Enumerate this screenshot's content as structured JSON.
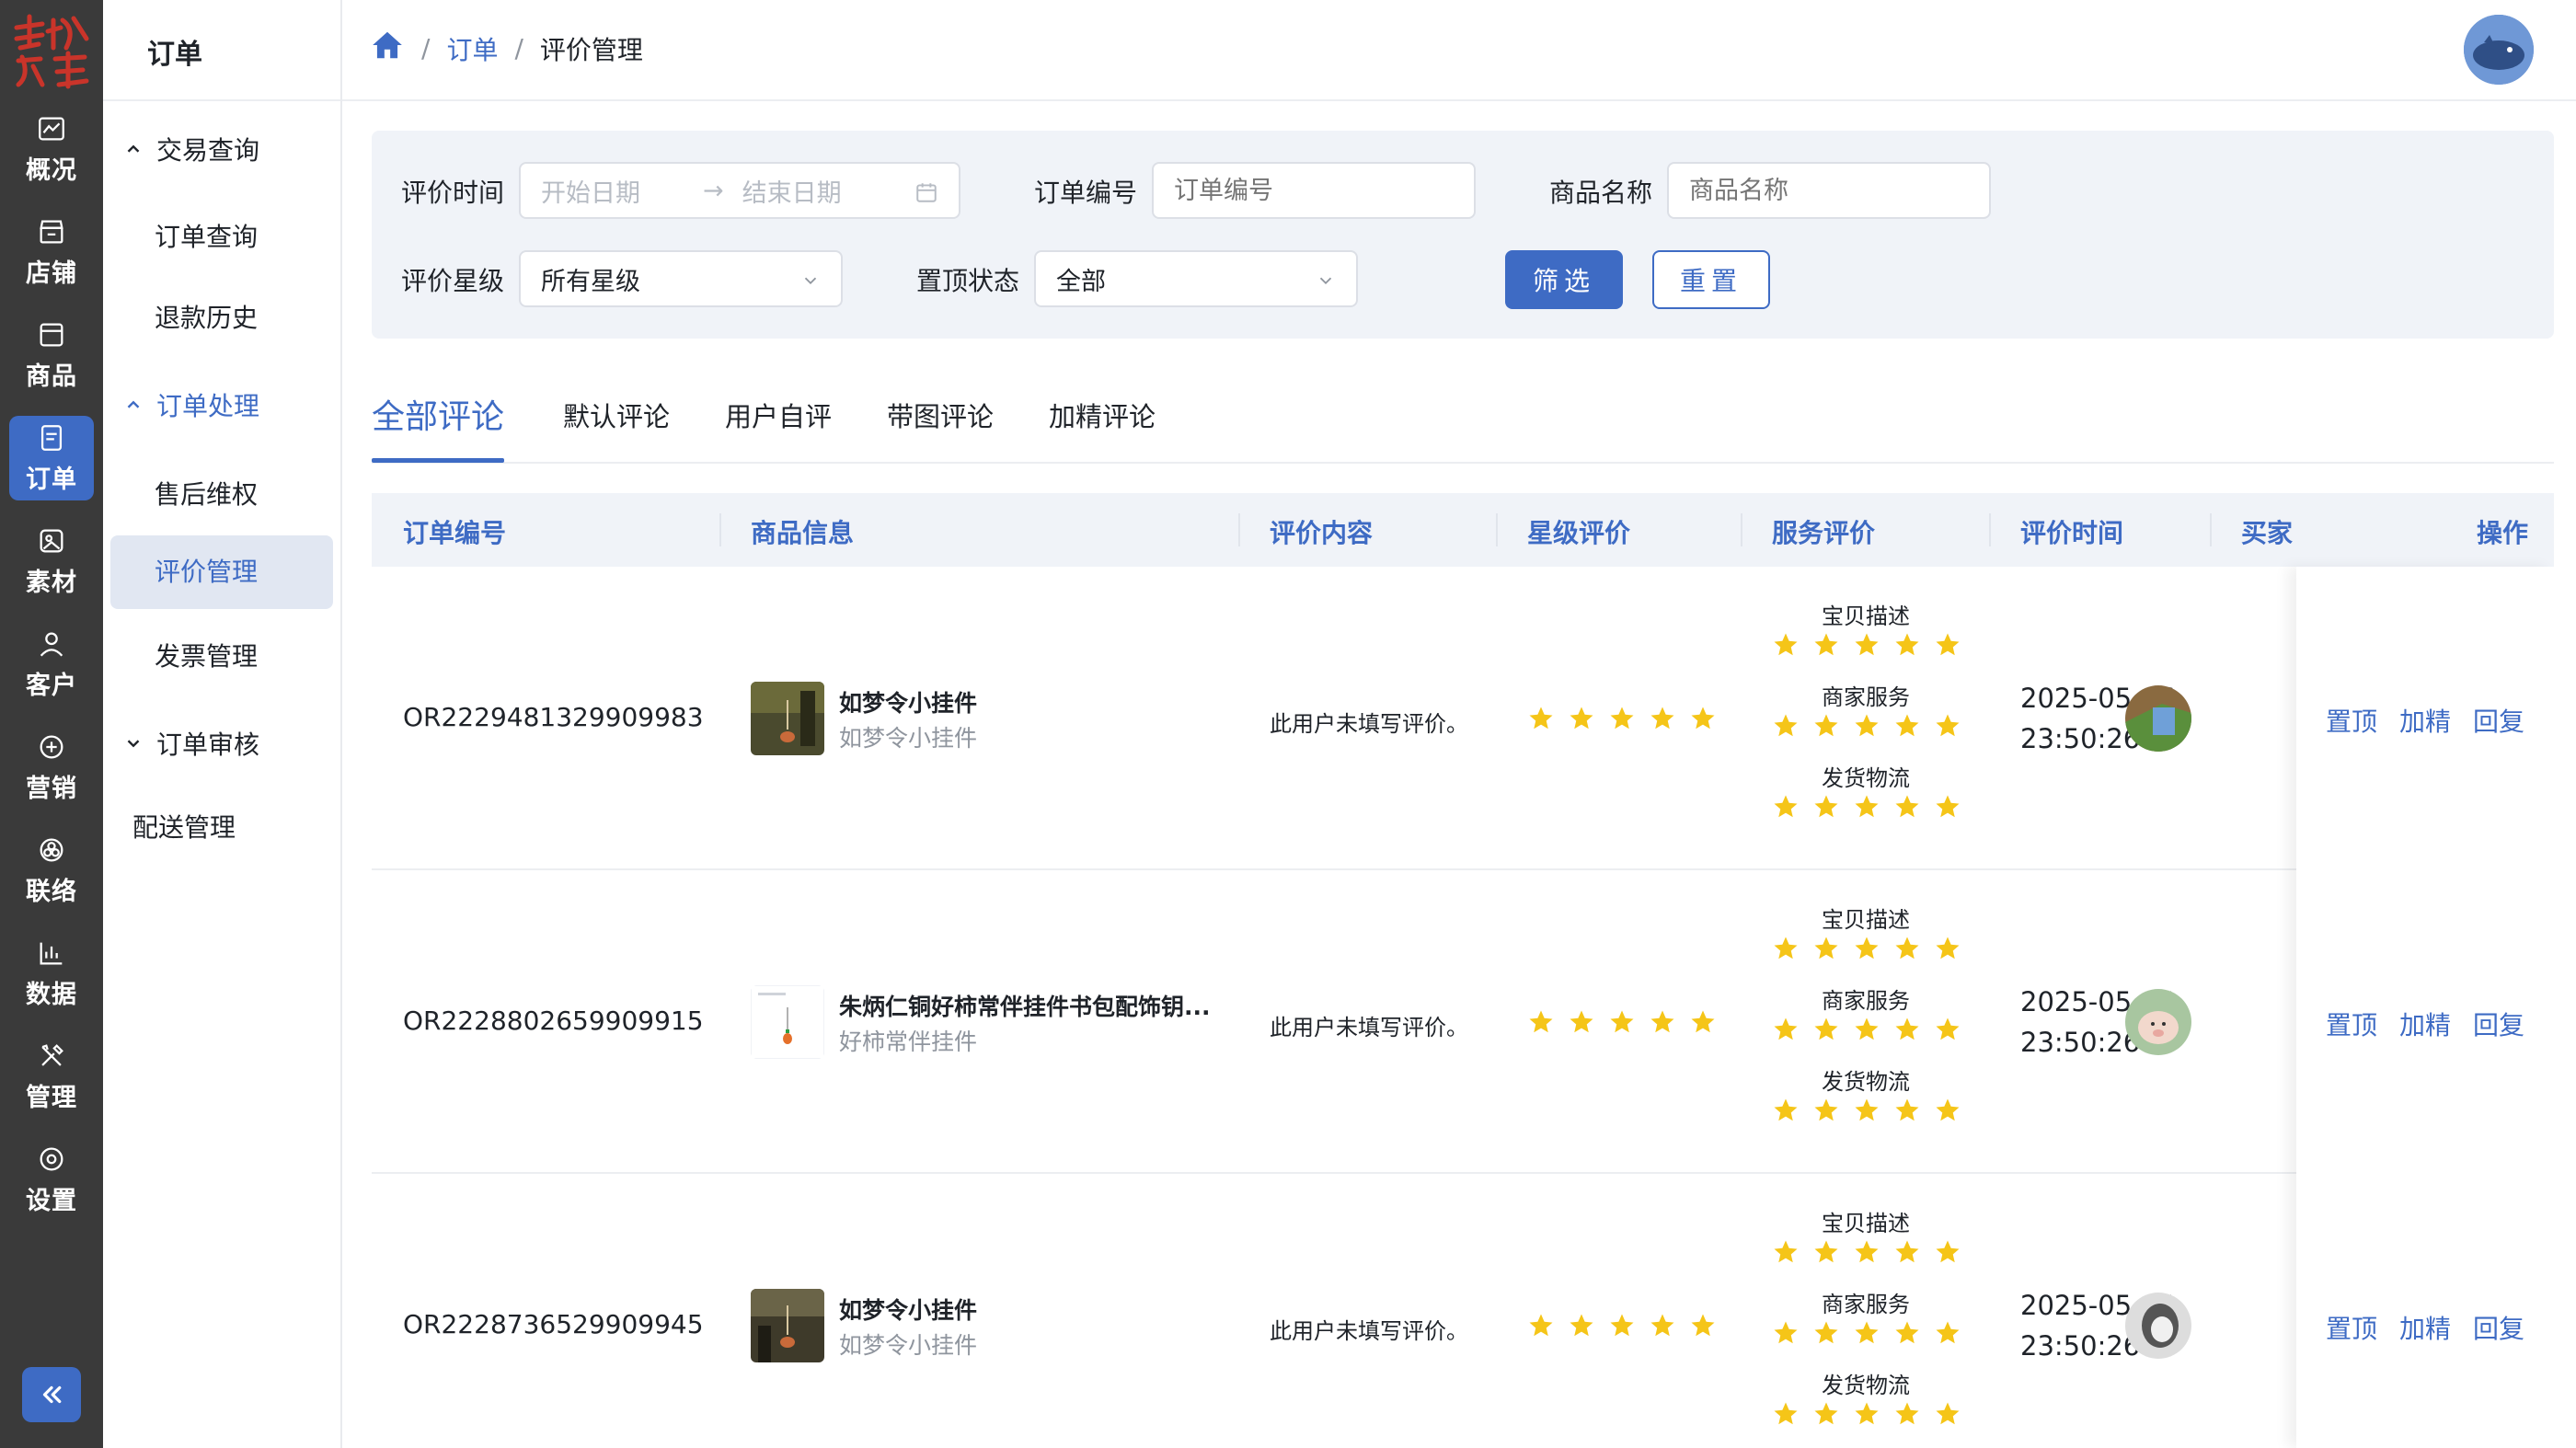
{
  "rail": {
    "items": [
      {
        "label": "概况",
        "icon": "chart-icon"
      },
      {
        "label": "店铺",
        "icon": "store-icon"
      },
      {
        "label": "商品",
        "icon": "goods-icon"
      },
      {
        "label": "订单",
        "icon": "order-icon"
      },
      {
        "label": "素材",
        "icon": "material-icon"
      },
      {
        "label": "客户",
        "icon": "user-icon"
      },
      {
        "label": "营销",
        "icon": "marketing-icon"
      },
      {
        "label": "联络",
        "icon": "contact-icon"
      },
      {
        "label": "数据",
        "icon": "data-icon"
      },
      {
        "label": "管理",
        "icon": "tools-icon"
      },
      {
        "label": "设置",
        "icon": "settings-icon"
      }
    ],
    "active_index": 3
  },
  "submenu": {
    "title": "订单",
    "group1": "交易查询",
    "group1_items": [
      "订单查询",
      "退款历史"
    ],
    "group2": "订单处理",
    "group2_items": [
      "售后维权",
      "评价管理",
      "发票管理"
    ],
    "group3": "订单审核",
    "plain": "配送管理"
  },
  "breadcrumb": {
    "level1": "订单",
    "level2": "评价管理",
    "sep": "/"
  },
  "filters": {
    "time_label": "评价时间",
    "start_placeholder": "开始日期",
    "arrow": "→",
    "end_placeholder": "结束日期",
    "order_label": "订单编号",
    "order_placeholder": "订单编号",
    "product_label": "商品名称",
    "product_placeholder": "商品名称",
    "rating_label": "评价星级",
    "rating_value": "所有星级",
    "pin_label": "置顶状态",
    "pin_value": "全部",
    "filter_btn": "筛选",
    "reset_btn": "重置"
  },
  "tabs": [
    "全部评论",
    "默认评论",
    "用户自评",
    "带图评论",
    "加精评论"
  ],
  "table": {
    "headers": [
      "订单编号",
      "商品信息",
      "评价内容",
      "星级评价",
      "服务评价",
      "评价时间",
      "买家",
      "操作"
    ],
    "service_labels": [
      "宝贝描述",
      "商家服务",
      "发货物流"
    ],
    "actions": [
      "置顶",
      "加精",
      "回复"
    ],
    "rows": [
      {
        "order": "OR2229481329909983",
        "product": "如梦令小挂件",
        "sku": "如梦令小挂件",
        "content": "此用户未填写评价。",
        "stars": 5,
        "date": "2025-05-06",
        "time": "23:50:26"
      },
      {
        "order": "OR2228802659909915",
        "product": "朱炳仁铜好柿常伴挂件书包配饰钥...",
        "sku": "好柿常伴挂件",
        "content": "此用户未填写评价。",
        "stars": 5,
        "date": "2025-05-04",
        "time": "23:50:26"
      },
      {
        "order": "OR2228736529909945",
        "product": "如梦令小挂件",
        "sku": "如梦令小挂件",
        "content": "此用户未填写评价。",
        "stars": 5,
        "date": "2025-05-04",
        "time": "23:50:26"
      }
    ]
  },
  "colors": {
    "accent": "#3e6bc4",
    "rail_bg": "#3a3a3a",
    "star": "#f5c518",
    "panel_bg": "#f0f3f8"
  }
}
